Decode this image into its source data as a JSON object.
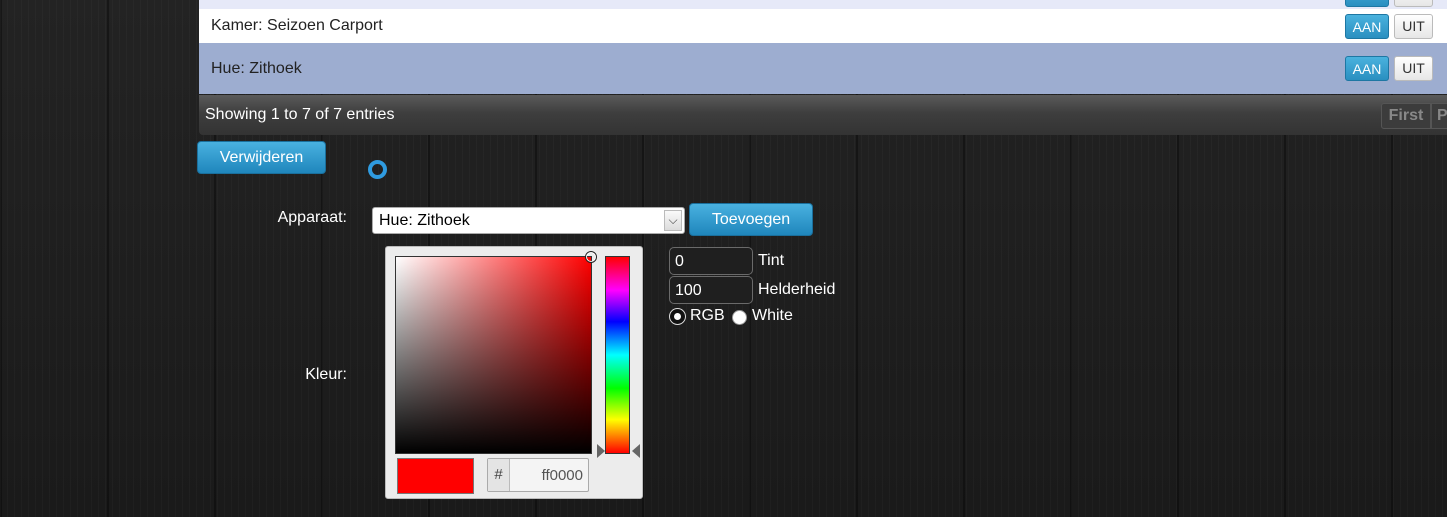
{
  "device_rows": [
    {
      "label": "Kamer: Seizoen Carport",
      "on_label": "AAN",
      "off_label": "UIT"
    },
    {
      "label": "Hue: Zithoek",
      "on_label": "AAN",
      "off_label": "UIT"
    }
  ],
  "table_footer": {
    "info": "Showing 1 to 7 of 7 entries",
    "first_label": "First",
    "previous_label": "P"
  },
  "actions": {
    "delete_label": "Verwijderen",
    "add_label": "Toevoegen"
  },
  "form": {
    "device_label": "Apparaat:",
    "device_selected": "Hue: Zithoek",
    "color_label": "Kleur:"
  },
  "color_picker": {
    "hash_label": "#",
    "hex_value": "ff0000",
    "swatch_color": "#ff0000"
  },
  "light_settings": {
    "hue_value": "0",
    "hue_label": "Tint",
    "brightness_value": "100",
    "brightness_label": "Helderheid",
    "mode_options": [
      "RGB",
      "White"
    ],
    "mode_selected": "RGB"
  },
  "colors": {
    "accent_blue": "#2a8fc0",
    "selected_row": "#9dadd0",
    "top_row": "#e6e9f8"
  }
}
